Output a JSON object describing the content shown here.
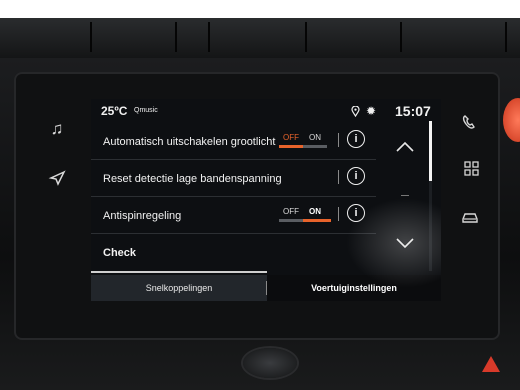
{
  "status": {
    "temperature": "25ºC",
    "source": "Qmusic",
    "time": "15:07"
  },
  "rows": [
    {
      "label": "Automatisch uitschakelen grootlicht",
      "off": "OFF",
      "on": "ON",
      "state": "off"
    },
    {
      "label": "Reset detectie lage bandenspanning"
    },
    {
      "label": "Antispinregeling",
      "off": "OFF",
      "on": "ON",
      "state": "on"
    },
    {
      "label": "Check"
    }
  ],
  "tabs": {
    "left": "Snelkoppelingen",
    "right": "Voertuiginstellingen",
    "active": "right"
  },
  "icons": {
    "location": "location-pin-icon",
    "settings": "gear-icon",
    "info": "info-icon",
    "scroll_up": "chevron-up-icon",
    "scroll_down": "chevron-down-icon",
    "music": "music-note-icon",
    "navigation": "navigation-arrow-icon",
    "phone": "phone-icon",
    "apps": "apps-grid-icon",
    "car": "car-icon"
  },
  "colors": {
    "accent": "#e8632b",
    "screen_bg": "#0d0f12",
    "text": "#f2f2f2"
  }
}
